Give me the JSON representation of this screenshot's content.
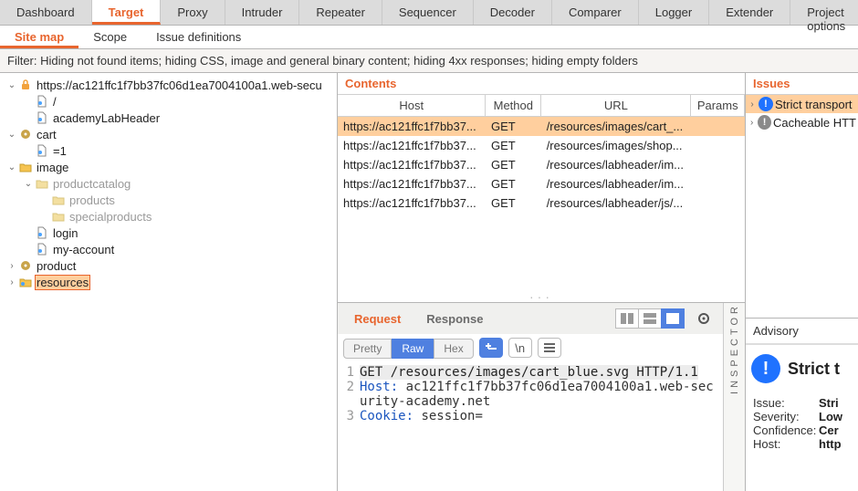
{
  "top_tabs": [
    "Dashboard",
    "Target",
    "Proxy",
    "Intruder",
    "Repeater",
    "Sequencer",
    "Decoder",
    "Comparer",
    "Logger",
    "Extender",
    "Project options"
  ],
  "top_tab_active": 1,
  "sub_tabs": [
    "Site map",
    "Scope",
    "Issue definitions"
  ],
  "sub_tab_active": 0,
  "filter_text": "Filter: Hiding not found items;  hiding CSS, image and general binary content;  hiding 4xx responses;  hiding empty folders",
  "tree": {
    "root": "https://ac121ffc1f7bb37fc06d1ea7004100a1.web-secu",
    "items": [
      {
        "depth": 1,
        "toggle": "open",
        "icon": "lock",
        "label": "https://ac121ffc1f7bb37fc06d1ea7004100a1.web-secu"
      },
      {
        "depth": 2,
        "toggle": "none",
        "icon": "file",
        "label": "/"
      },
      {
        "depth": 2,
        "toggle": "none",
        "icon": "file",
        "label": "academyLabHeader"
      },
      {
        "depth": 1,
        "toggle": "open",
        "icon": "gear",
        "label": "cart"
      },
      {
        "depth": 2,
        "toggle": "none",
        "icon": "file",
        "label": "=1"
      },
      {
        "depth": 1,
        "toggle": "open",
        "icon": "folder",
        "label": "image"
      },
      {
        "depth": 2,
        "toggle": "open",
        "icon": "folder-grey",
        "label": "productcatalog",
        "grey": true
      },
      {
        "depth": 3,
        "toggle": "none",
        "icon": "folder-grey",
        "label": "products",
        "grey": true
      },
      {
        "depth": 3,
        "toggle": "none",
        "icon": "folder-grey",
        "label": "specialproducts",
        "grey": true
      },
      {
        "depth": 2,
        "toggle": "none",
        "icon": "file",
        "label": "login"
      },
      {
        "depth": 2,
        "toggle": "none",
        "icon": "file",
        "label": "my-account"
      },
      {
        "depth": 1,
        "toggle": "closed",
        "icon": "gear",
        "label": "product"
      },
      {
        "depth": 1,
        "toggle": "closed",
        "icon": "folder-blue",
        "label": "resources",
        "selected": true
      }
    ]
  },
  "contents": {
    "title": "Contents",
    "columns": [
      "Host",
      "Method",
      "URL",
      "Params"
    ],
    "rows": [
      {
        "host": "https://ac121ffc1f7bb37...",
        "method": "GET",
        "url": "/resources/images/cart_...",
        "params": ""
      },
      {
        "host": "https://ac121ffc1f7bb37...",
        "method": "GET",
        "url": "/resources/images/shop...",
        "params": ""
      },
      {
        "host": "https://ac121ffc1f7bb37...",
        "method": "GET",
        "url": "/resources/labheader/im...",
        "params": ""
      },
      {
        "host": "https://ac121ffc1f7bb37...",
        "method": "GET",
        "url": "/resources/labheader/im...",
        "params": ""
      },
      {
        "host": "https://ac121ffc1f7bb37...",
        "method": "GET",
        "url": "/resources/labheader/js/...",
        "params": ""
      }
    ]
  },
  "reqres": {
    "tabs": [
      "Request",
      "Response"
    ],
    "active": 0,
    "formats": [
      "Pretty",
      "Raw",
      "Hex"
    ],
    "format_active": 1,
    "lines": [
      {
        "n": 1,
        "raw": "GET /resources/images/cart_blue.svg HTTP/1.1",
        "sel": true
      },
      {
        "n": 2,
        "key": "Host",
        "val": "ac121ffc1f7bb37fc06d1ea7004100a1.web-security-academy.net"
      },
      {
        "n": 3,
        "key": "Cookie",
        "val": "session="
      }
    ]
  },
  "inspector_label": "INSPECTOR",
  "issues": {
    "title": "Issues",
    "rows": [
      {
        "badge": "blue",
        "label": "Strict transport",
        "selected": true
      },
      {
        "badge": "grey",
        "label": "Cacheable HTT"
      }
    ]
  },
  "advisory": {
    "tab": "Advisory",
    "title": "Strict t",
    "kv": [
      {
        "k": "Issue:",
        "v": "Stri"
      },
      {
        "k": "Severity:",
        "v": "Low"
      },
      {
        "k": "Confidence:",
        "v": "Cer"
      },
      {
        "k": "Host:",
        "v": "http"
      }
    ]
  }
}
